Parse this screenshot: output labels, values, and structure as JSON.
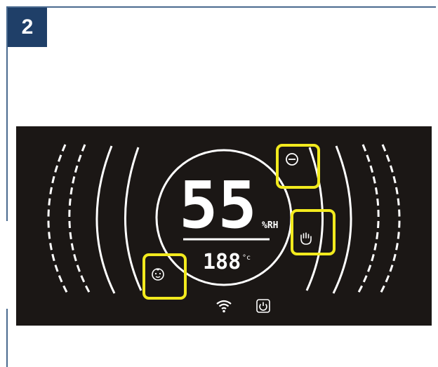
{
  "step": {
    "number": "2"
  },
  "display": {
    "humidity_value": "55",
    "humidity_unit": "%RH",
    "temperature_value": "188",
    "temperature_unit": "°c"
  },
  "icons": {
    "minus": "minus-circle-icon",
    "hand": "hand-icon",
    "baby": "baby-face-icon",
    "wifi": "wifi-icon",
    "power": "power-icon"
  },
  "colors": {
    "panel_bg": "#1b1715",
    "highlight": "#f2ea1e",
    "badge_bg": "#1f3f68",
    "frame": "#4a6a8f"
  }
}
